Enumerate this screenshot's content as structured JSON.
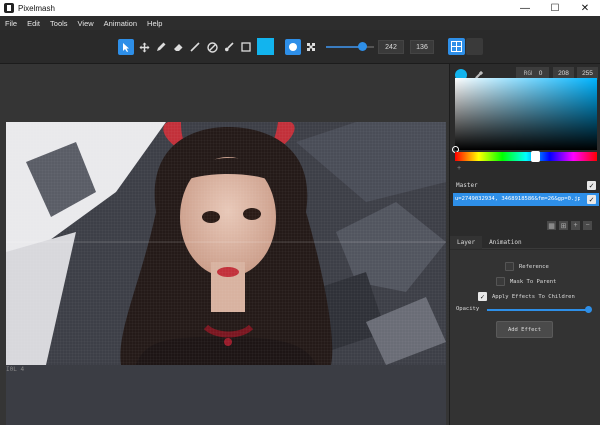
{
  "window": {
    "title": "Pixelmash",
    "controls": [
      "—",
      "☐",
      "✕"
    ]
  },
  "menu": [
    "File",
    "Edit",
    "Tools",
    "View",
    "Animation",
    "Help"
  ],
  "toolbar": {
    "tools": [
      "select",
      "move",
      "pencil",
      "eraser",
      "line",
      "fill",
      "brush",
      "rectangle"
    ],
    "active_tool": "select",
    "primary_color": "#12b4ee",
    "brush_round": "brush-round",
    "brush_scatter": "brush-scatter",
    "width_value": "242",
    "height_value": "136",
    "grid_toggle": "grid"
  },
  "canvas": {
    "status": "I0L    4"
  },
  "color_panel": {
    "mode": "RGB:",
    "r": "0",
    "g": "208",
    "b": "255",
    "accent": "#12b4ee"
  },
  "layers": {
    "master_label": "Master",
    "selected_layer": "u=2749032934, 3468918586&fm=26&gp=0.jpg",
    "actions": [
      "▦",
      "⊞",
      "+",
      "−"
    ]
  },
  "tabs": {
    "layer": "Layer",
    "animation": "Animation"
  },
  "properties": {
    "reference": "Reference",
    "mask_to_parent": "Mask To Parent",
    "apply_effects": "Apply Effects To Children",
    "opacity_label": "Opacity",
    "opacity_value": 1.0,
    "add_effect": "Add Effect"
  }
}
